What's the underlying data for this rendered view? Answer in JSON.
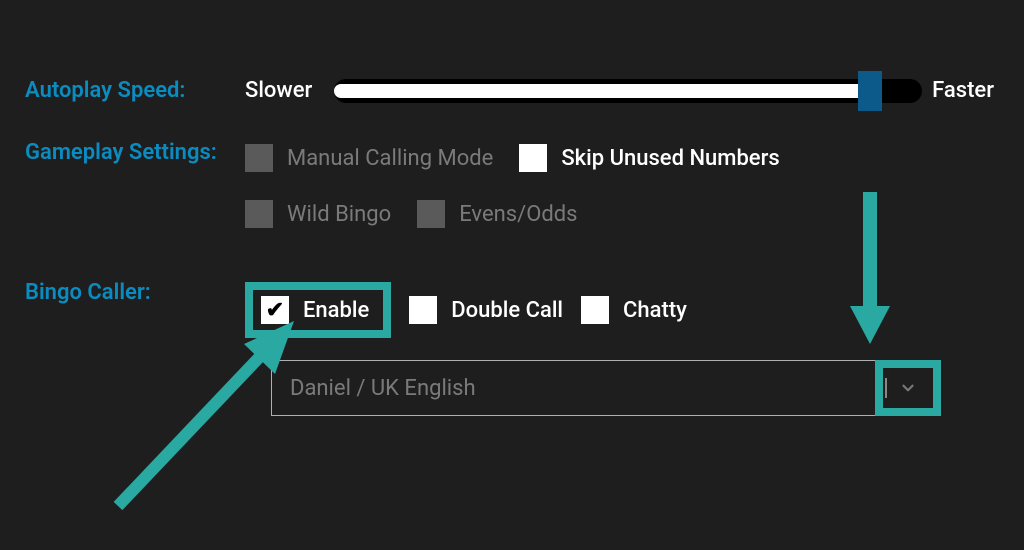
{
  "colors": {
    "accent_label": "#0b8cc1",
    "highlight": "#2aa8a2",
    "slider_thumb": "#0b5a8a"
  },
  "autoplay": {
    "label": "Autoplay Speed:",
    "slower_label": "Slower",
    "faster_label": "Faster",
    "value_percent": 93
  },
  "gameplay": {
    "label": "Gameplay Settings:",
    "options": {
      "manual_calling": {
        "label": "Manual Calling Mode",
        "checked": false,
        "enabled": false
      },
      "skip_unused": {
        "label": "Skip Unused Numbers",
        "checked": false,
        "enabled": true
      },
      "wild_bingo": {
        "label": "Wild Bingo",
        "checked": false,
        "enabled": false
      },
      "evens_odds": {
        "label": "Evens/Odds",
        "checked": false,
        "enabled": false
      }
    }
  },
  "caller": {
    "label": "Bingo Caller:",
    "enable": {
      "label": "Enable",
      "checked": true
    },
    "double_call": {
      "label": "Double Call",
      "checked": false
    },
    "chatty": {
      "label": "Chatty",
      "checked": false
    },
    "voice_selected": "Daniel / UK English"
  }
}
